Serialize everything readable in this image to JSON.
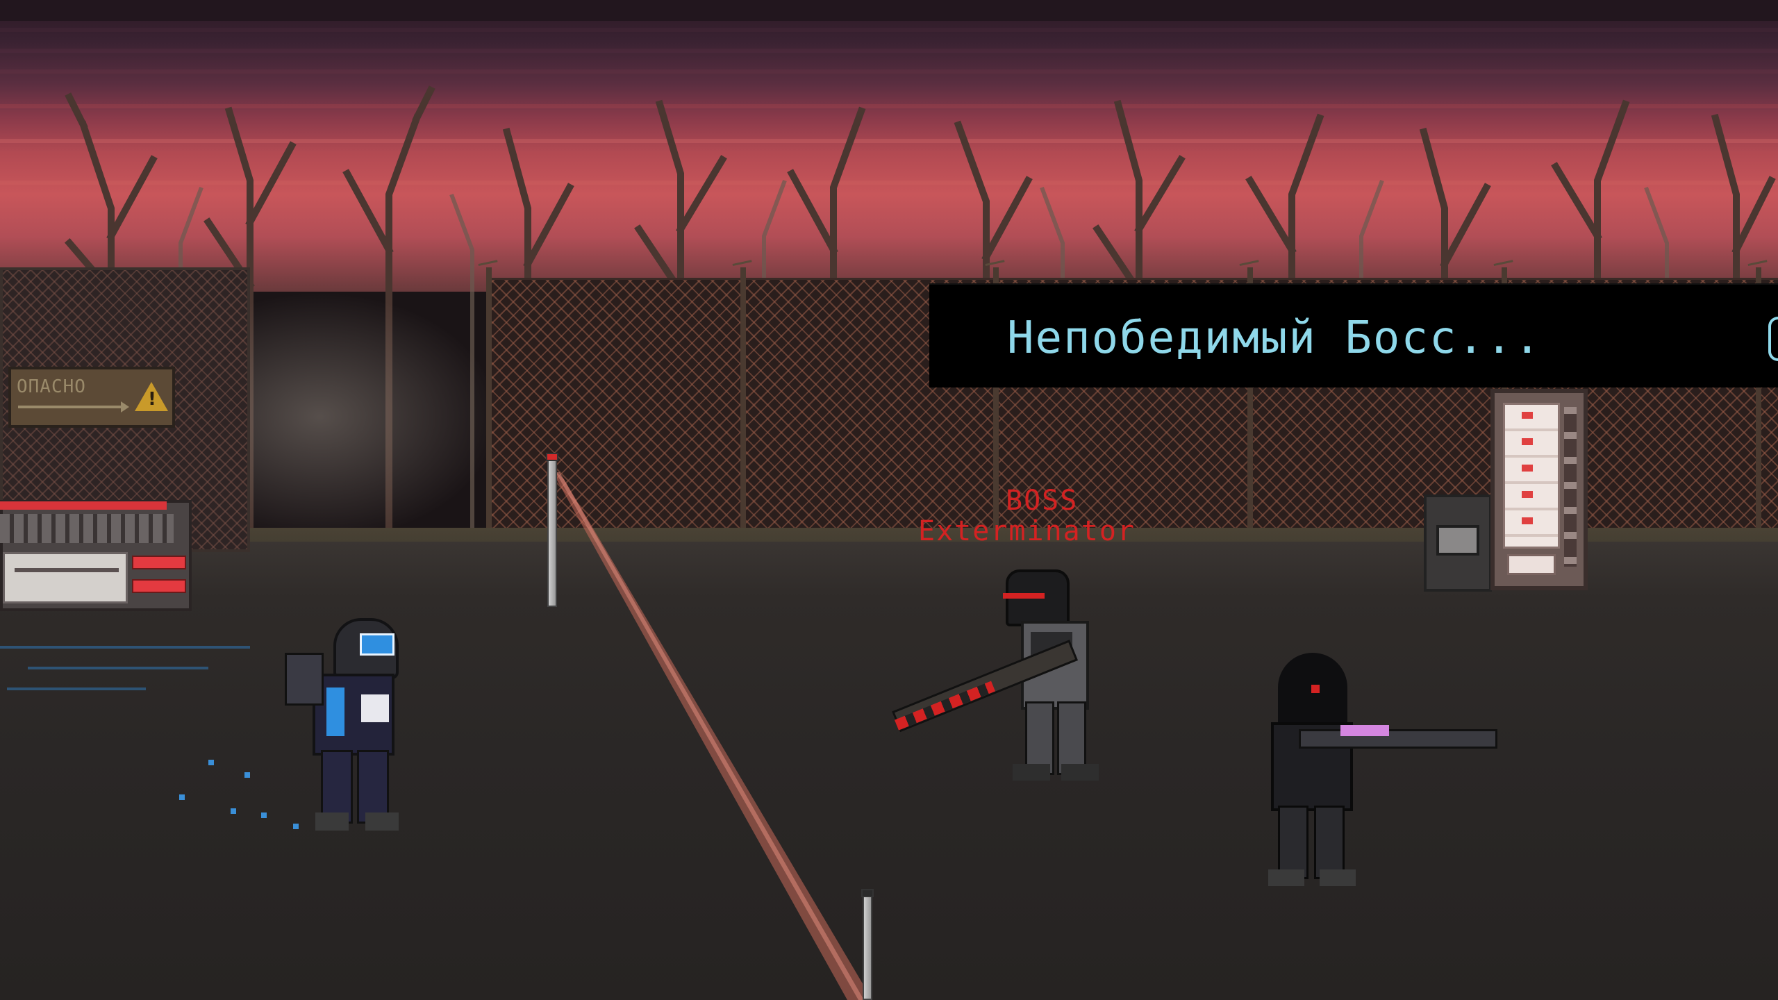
{
  "hud": {
    "dialog_text": "Непобедимый Босс...",
    "boss_tag": "BOSS",
    "boss_name": "Exterminator"
  },
  "environment": {
    "warning_sign_text": "ОПАСНО",
    "warning_icon_glyph": "!"
  },
  "colors": {
    "dialog_text": "#8fd8ea",
    "boss_label": "#d42222",
    "laser": "#c86a5a",
    "player_accent": "#2f8fe0"
  },
  "icons": [
    "warning-icon"
  ]
}
